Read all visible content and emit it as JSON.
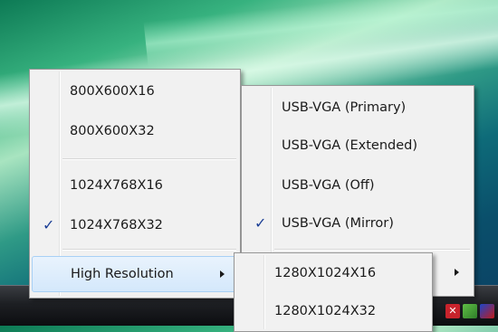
{
  "desktop": {
    "tray_icons": [
      "shield-icon",
      "network-icon",
      "usb-display-icon"
    ]
  },
  "menu_main": {
    "items": [
      {
        "label": "800X600X16",
        "checked": false
      },
      {
        "label": "800X600X32",
        "checked": false
      },
      {
        "label": "1024X768X16",
        "checked": false
      },
      {
        "label": "1024X768X32",
        "checked": true,
        "check_mark": "✓"
      }
    ],
    "high_resolution": {
      "label": "High Resolution",
      "has_submenu": true
    }
  },
  "menu_usb": {
    "items": [
      {
        "label": "USB-VGA (Primary)",
        "checked": false
      },
      {
        "label": "USB-VGA (Extended)",
        "checked": false
      },
      {
        "label": "USB-VGA (Off)",
        "checked": false
      },
      {
        "label": "USB-VGA (Mirror)",
        "checked": true,
        "check_mark": "✓"
      }
    ],
    "more_arrow": true
  },
  "menu_highres": {
    "items": [
      {
        "label": "1280X1024X16"
      },
      {
        "label": "1280X1024X32"
      }
    ]
  },
  "colors": {
    "menu_bg": "#f1f1f1",
    "highlight": "#d4e8fb",
    "check": "#1c3f96"
  }
}
